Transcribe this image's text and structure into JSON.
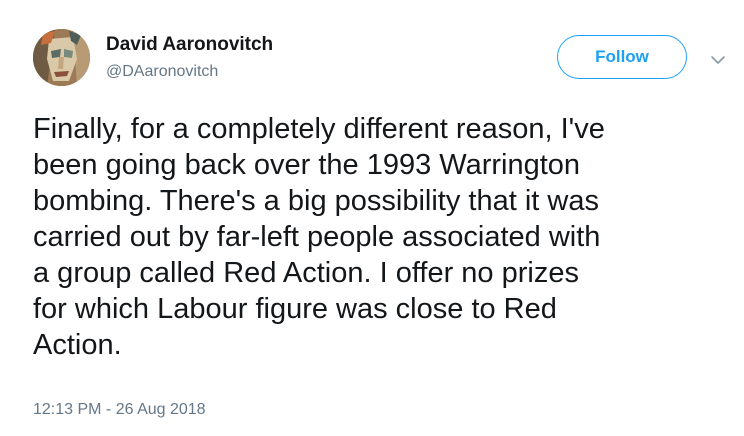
{
  "author": {
    "display_name": "David Aaronovitch",
    "handle": "@DAaronovitch",
    "avatar_icon": "avatar-portrait-icon"
  },
  "actions": {
    "follow_label": "Follow",
    "more_icon": "chevron-down-icon"
  },
  "tweet": {
    "text": "Finally, for a completely different reason, I've\nbeen going back over the 1993 Warrington\nbombing. There's a big possibility that it was\ncarried out by far-left people associated with\na group called Red Action. I offer no prizes\nfor which Labour figure was close to Red\nAction.",
    "timestamp": "12:13 PM - 26 Aug 2018"
  },
  "colors": {
    "accent": "#1da1f2",
    "secondary_text": "#657786",
    "primary_text": "#14171a"
  }
}
